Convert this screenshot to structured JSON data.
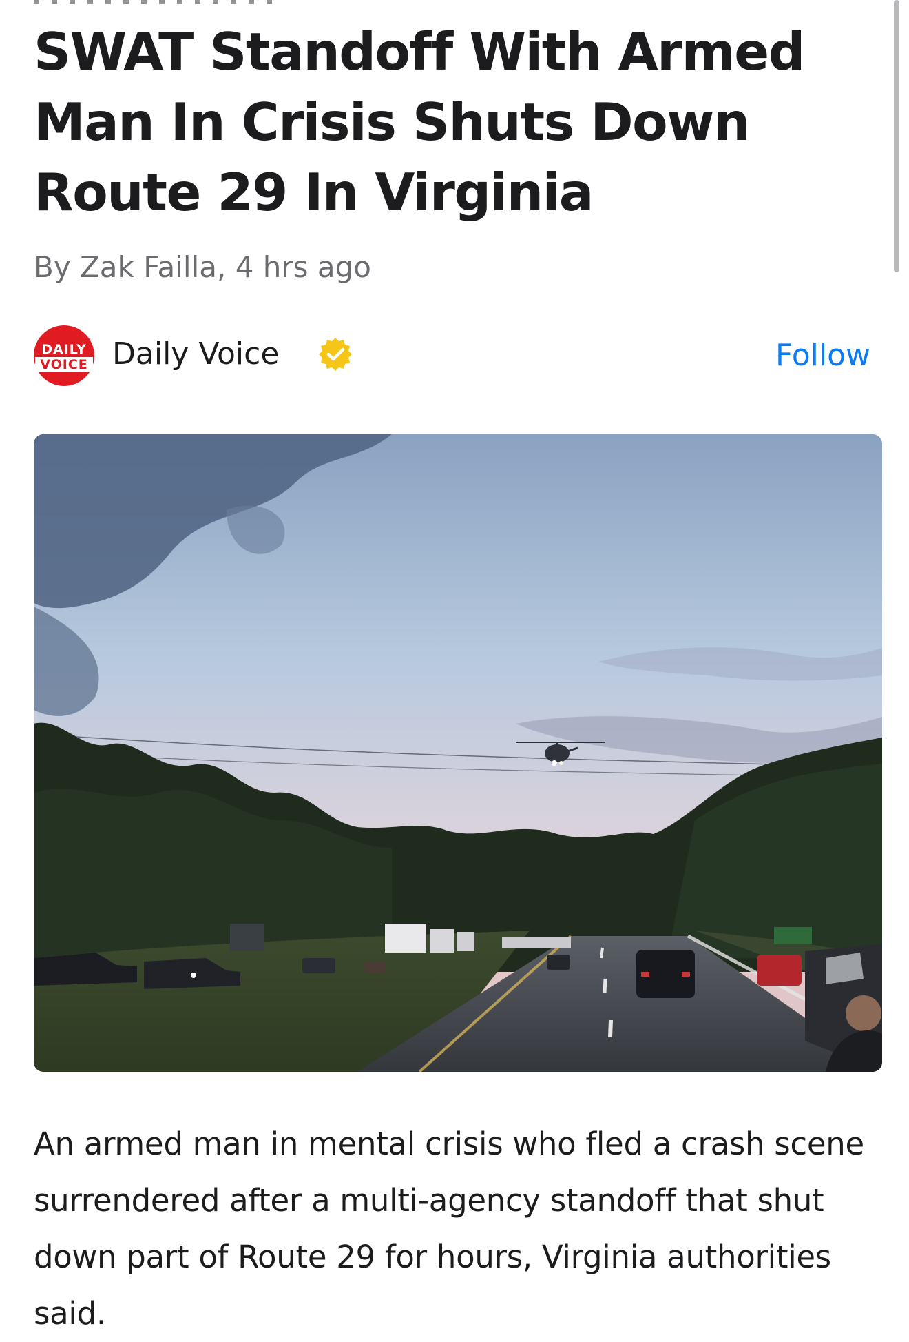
{
  "article": {
    "title": "SWAT Standoff With Armed Man In Crisis Shuts Down Route 29 In Virginia",
    "byline": "By Zak Failla, 4 hrs ago",
    "body": "An armed man in mental crisis who fled a crash scene surrendered after a multi-agency standoff that shut down part of Route 29 for hours, Virginia authorities said."
  },
  "source": {
    "name": "Daily Voice",
    "logo_line1": "DAILY",
    "logo_line2": "VOICE",
    "verified_icon": "verified-badge-icon",
    "follow_label": "Follow"
  },
  "photo": {
    "subject": "highway-helicopter-photo"
  },
  "colors": {
    "accent": "#0a7cf5",
    "brand_red": "#e01b22",
    "verified_gold": "#f5c518",
    "text": "#1c1c1e",
    "muted": "#6b6b70"
  }
}
